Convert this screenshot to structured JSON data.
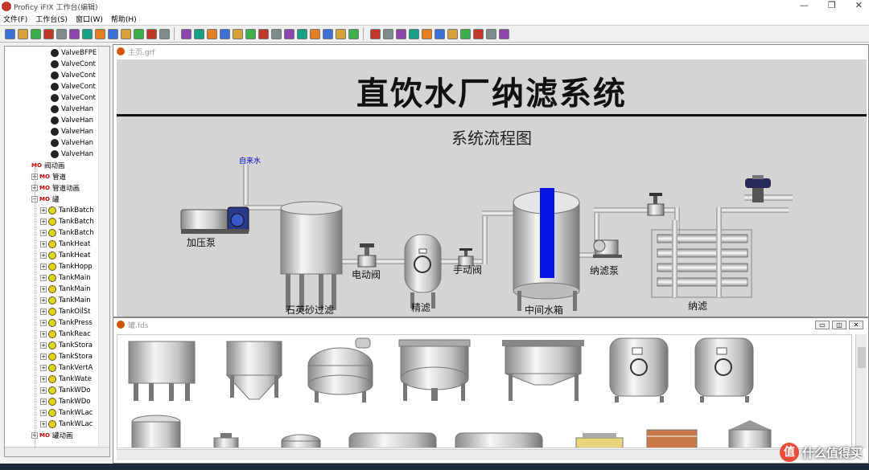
{
  "window": {
    "title": "Proficy iFIX 工作台(编辑)",
    "controls": [
      "—",
      "❐",
      "✕"
    ]
  },
  "menu": [
    "文件(F)",
    "工作台(S)",
    "窗口(W)",
    "帮助(H)"
  ],
  "toolbar": {
    "button_count": 38,
    "separator_after": [
      13,
      27
    ]
  },
  "tree": {
    "valves": [
      "ValveBFPE",
      "ValveCont",
      "ValveCont",
      "ValveCont",
      "ValveCont",
      "ValveHan",
      "ValveHan",
      "ValveHan",
      "ValveHan",
      "ValveHan"
    ],
    "groups": [
      "阀动画",
      "管道",
      "管道动画",
      "罐"
    ],
    "tanks": [
      "TankBatch",
      "TankBatch",
      "TankBatch",
      "TankHeat",
      "TankHeat",
      "TankHopp",
      "TankMain",
      "TankMain",
      "TankMain",
      "TankOilSt",
      "TankPress",
      "TankReac",
      "TankStora",
      "TankStora",
      "TankVertA",
      "TankWate",
      "TankWDo",
      "TankWDo",
      "TankWLac",
      "TankWLac"
    ],
    "last_group": "罐动画"
  },
  "main_doc": {
    "tab_title": "主页.grf",
    "title": "直饮水厂纳滤系统",
    "subtitle": "系统流程图",
    "labels": {
      "tap_water": "自来水",
      "pump": "加压泵",
      "sand_filter": "石英砂过滤",
      "electric_valve": "电动阀",
      "fine_filter": "精滤",
      "manual_valve": "手动阀",
      "mid_tank": "中间水箱",
      "nf_pump": "纳滤泵",
      "nf": "纳滤"
    }
  },
  "tank_doc": {
    "tab_title": "罐.fds",
    "buttons": [
      "▭",
      "◫",
      "✕"
    ]
  },
  "watermark": {
    "badge": "值",
    "text": "什么值得买"
  },
  "colors": {
    "accent_blue": "#0000cc",
    "tank_level_blue": "#0a14e6",
    "canvas": "#d4d4d4"
  }
}
